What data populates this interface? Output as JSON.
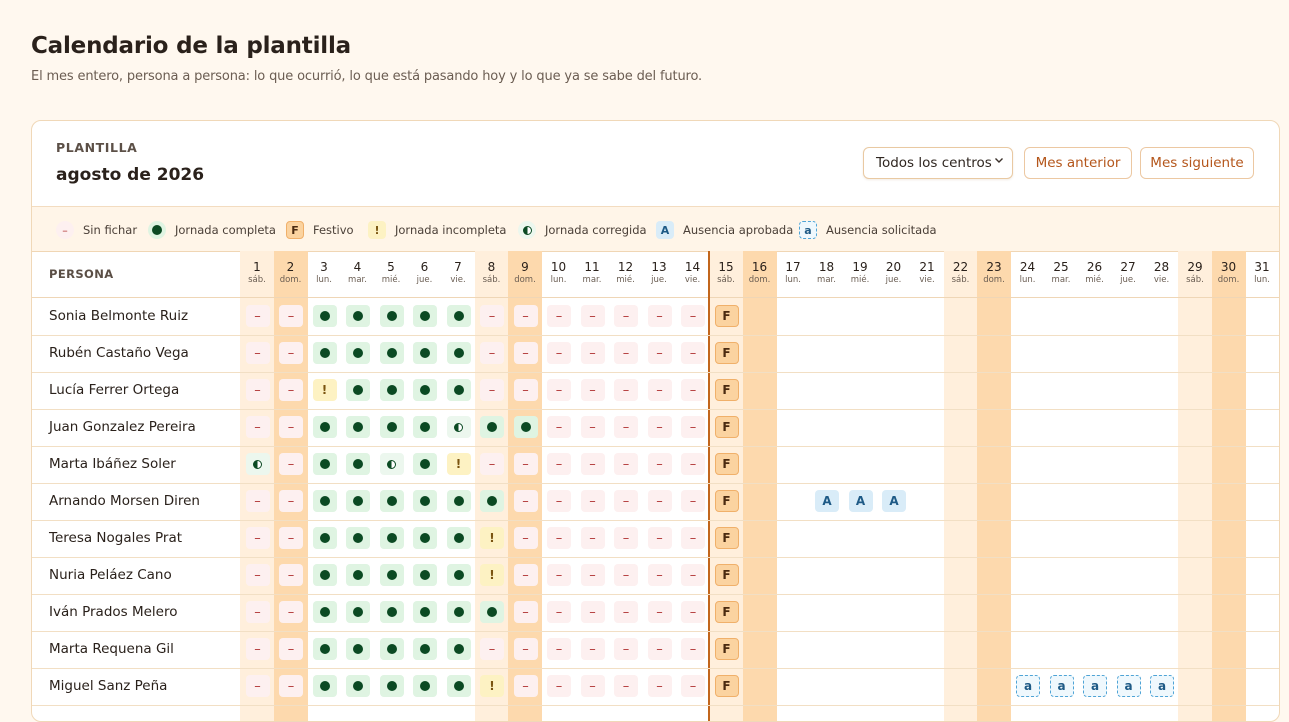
{
  "page": {
    "title": "Calendario de la plantilla",
    "subtitle": "El mes entero, persona a persona: lo que ocurrió, lo que está pasando hoy y lo que ya se sabe del futuro."
  },
  "card": {
    "eyebrow": "PLANTILLA",
    "month": "agosto de 2026",
    "center_select": "Todos los centros",
    "prev_label": "Mes anterior",
    "next_label": "Mes siguiente"
  },
  "legend": [
    {
      "key": "none",
      "symbol": "–",
      "label": "Sin fichar"
    },
    {
      "key": "full",
      "symbol": "●",
      "label": "Jornada completa"
    },
    {
      "key": "holiday",
      "symbol": "F",
      "label": "Festivo"
    },
    {
      "key": "partial",
      "symbol": "!",
      "label": "Jornada incompleta"
    },
    {
      "key": "half",
      "symbol": "◑",
      "label": "Jornada corregida"
    },
    {
      "key": "approved",
      "symbol": "A",
      "label": "Ausencia aprobada"
    },
    {
      "key": "requested",
      "symbol": "a",
      "label": "Ausencia solicitada"
    }
  ],
  "table": {
    "person_header": "PERSONA",
    "today_index": 14,
    "days": [
      {
        "n": "1",
        "w": "sáb.",
        "t": "sat"
      },
      {
        "n": "2",
        "w": "dom.",
        "t": "sun"
      },
      {
        "n": "3",
        "w": "lun.",
        "t": "wk"
      },
      {
        "n": "4",
        "w": "mar.",
        "t": "wk"
      },
      {
        "n": "5",
        "w": "mié.",
        "t": "wk"
      },
      {
        "n": "6",
        "w": "jue.",
        "t": "wk"
      },
      {
        "n": "7",
        "w": "vie.",
        "t": "wk"
      },
      {
        "n": "8",
        "w": "sáb.",
        "t": "sat"
      },
      {
        "n": "9",
        "w": "dom.",
        "t": "sun"
      },
      {
        "n": "10",
        "w": "lun.",
        "t": "wk"
      },
      {
        "n": "11",
        "w": "mar.",
        "t": "wk"
      },
      {
        "n": "12",
        "w": "mié.",
        "t": "wk"
      },
      {
        "n": "13",
        "w": "jue.",
        "t": "wk"
      },
      {
        "n": "14",
        "w": "vie.",
        "t": "wk"
      },
      {
        "n": "15",
        "w": "sáb.",
        "t": "sat"
      },
      {
        "n": "16",
        "w": "dom.",
        "t": "sun"
      },
      {
        "n": "17",
        "w": "lun.",
        "t": "wk"
      },
      {
        "n": "18",
        "w": "mar.",
        "t": "wk"
      },
      {
        "n": "19",
        "w": "mié.",
        "t": "wk"
      },
      {
        "n": "20",
        "w": "jue.",
        "t": "wk"
      },
      {
        "n": "21",
        "w": "vie.",
        "t": "wk"
      },
      {
        "n": "22",
        "w": "sáb.",
        "t": "sat"
      },
      {
        "n": "23",
        "w": "dom.",
        "t": "sun"
      },
      {
        "n": "24",
        "w": "lun.",
        "t": "wk"
      },
      {
        "n": "25",
        "w": "mar.",
        "t": "wk"
      },
      {
        "n": "26",
        "w": "mié.",
        "t": "wk"
      },
      {
        "n": "27",
        "w": "jue.",
        "t": "wk"
      },
      {
        "n": "28",
        "w": "vie.",
        "t": "wk"
      },
      {
        "n": "29",
        "w": "sáb.",
        "t": "sat"
      },
      {
        "n": "30",
        "w": "dom.",
        "t": "sun"
      },
      {
        "n": "31",
        "w": "lun.",
        "t": "wk"
      }
    ],
    "rows": [
      {
        "name": "Sonia Belmonte Ruiz",
        "cells": "--ooooo-------F"
      },
      {
        "name": "Rubén Castaño Vega",
        "cells": "--ooooo-------F"
      },
      {
        "name": "Lucía Ferrer Ortega",
        "cells": "--!oooo-------F"
      },
      {
        "name": "Juan Gonzalez Pereira",
        "cells": "--oooohoo-----F"
      },
      {
        "name": "Marta Ibáñez Soler",
        "cells": "h-ooho!-------F"
      },
      {
        "name": "Arnando Morsen Diren",
        "cells": "--oooooo------F..AAA"
      },
      {
        "name": "Teresa Nogales Prat",
        "cells": "--ooooo!------F"
      },
      {
        "name": "Nuria Peláez Cano",
        "cells": "--ooooo!------F"
      },
      {
        "name": "Iván Prados Melero",
        "cells": "--oooooo------F"
      },
      {
        "name": "Marta Requena Gil",
        "cells": "--ooooo-------F"
      },
      {
        "name": "Miguel Sanz Peña",
        "cells": "--ooooo!------F........aaaaa"
      }
    ]
  }
}
